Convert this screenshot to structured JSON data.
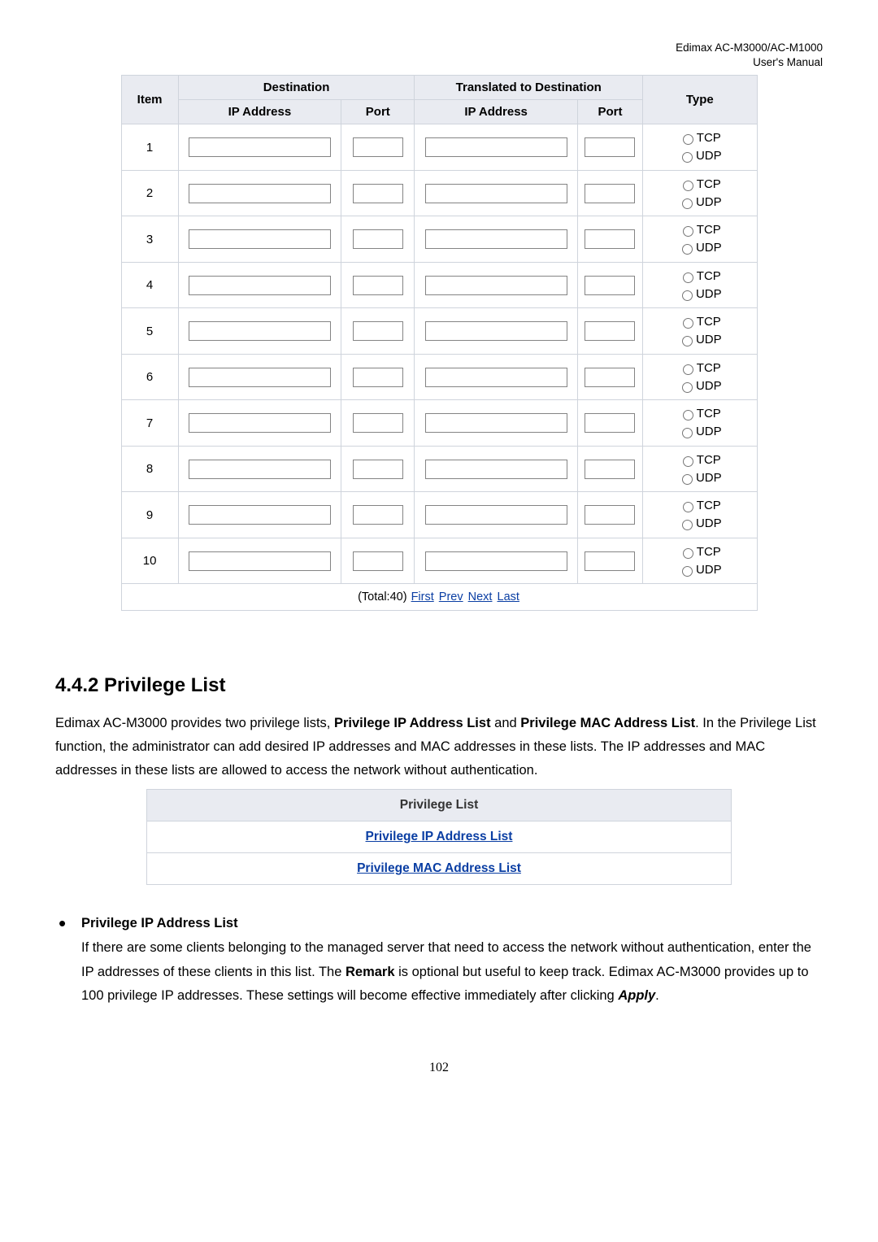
{
  "header": {
    "line1": "Edimax  AC-M3000/AC-M1000",
    "line2": "User's  Manual"
  },
  "nat_table": {
    "headers": {
      "item": "Item",
      "destination": "Destination",
      "translated": "Translated to Destination",
      "type": "Type",
      "ip": "IP Address",
      "port": "Port"
    },
    "rows": [
      {
        "n": "1"
      },
      {
        "n": "2"
      },
      {
        "n": "3"
      },
      {
        "n": "4"
      },
      {
        "n": "5"
      },
      {
        "n": "6"
      },
      {
        "n": "7"
      },
      {
        "n": "8"
      },
      {
        "n": "9"
      },
      {
        "n": "10"
      }
    ],
    "type_options": {
      "tcp": "TCP",
      "udp": "UDP"
    },
    "pager": {
      "total": "(Total:40)",
      "first": "First",
      "prev": "Prev",
      "next": "Next",
      "last": "Last"
    }
  },
  "section": {
    "heading": "4.4.2 Privilege List",
    "intro_1": "Edimax AC-M3000 provides two privilege lists, ",
    "intro_b1": "Privilege IP Address List",
    "intro_2": " and ",
    "intro_b2": "Privilege MAC Address List",
    "intro_3": ". In the Privilege List function, the administrator can add desired IP addresses and MAC addresses in these lists. The IP addresses and MAC addresses in these lists are allowed to access the network without authentication."
  },
  "priv_list": {
    "header": "Privilege List",
    "link_ip": "Privilege IP Address List",
    "link_mac": "Privilege MAC Address List"
  },
  "bullet": {
    "title": "Privilege IP Address List",
    "body_1": "If there are some clients belonging to the managed server that need to access the network without authentication, enter the IP addresses of these clients in this list. The ",
    "body_b1": "Remark",
    "body_2": " is optional but useful to keep track. Edimax AC-M3000 provides up to 100 privilege IP addresses. These settings will become effective immediately after clicking ",
    "body_bi": "Apply",
    "body_3": "."
  },
  "page_number": "102"
}
